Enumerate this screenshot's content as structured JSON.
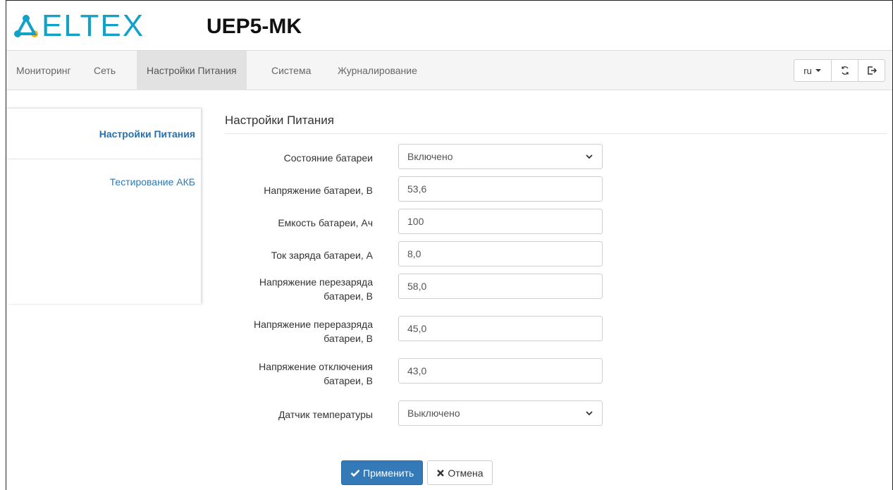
{
  "header": {
    "logo_text": "ELTEX",
    "device_name": "UEP5-MK"
  },
  "nav": {
    "items": [
      {
        "label": "Мониторинг"
      },
      {
        "label": "Сеть"
      },
      {
        "label": "Настройки Питания"
      },
      {
        "label": "Система"
      },
      {
        "label": "Журналирование"
      }
    ],
    "active": "Настройки Питания",
    "language": "ru"
  },
  "sidebar": {
    "items": [
      {
        "label": "Настройки Питания"
      },
      {
        "label": "Тестирование АКБ"
      }
    ]
  },
  "form": {
    "title": "Настройки Питания",
    "fields": [
      {
        "label": "Состояние батареи",
        "type": "select",
        "value": "Включено"
      },
      {
        "label": "Напряжение батареи, В",
        "type": "input",
        "value": "53,6"
      },
      {
        "label": "Емкость батареи, Ач",
        "type": "input",
        "value": "100"
      },
      {
        "label": "Ток заряда батареи, А",
        "type": "input",
        "value": "8,0"
      },
      {
        "label": "Напряжение перезаряда батареи, В",
        "type": "input",
        "value": "58,0"
      },
      {
        "label": "Напряжение переразряда батареи, В",
        "type": "input",
        "value": "45,0"
      },
      {
        "label": "Напряжение отключения батареи, В",
        "type": "input",
        "value": "43,0"
      },
      {
        "label": "Датчик температуры",
        "type": "select",
        "value": "Выключено"
      }
    ],
    "apply_label": "Применить",
    "cancel_label": "Отмена"
  },
  "colors": {
    "brand": "#13a1c8",
    "primary": "#3479b8",
    "link": "#2a7ab8"
  }
}
